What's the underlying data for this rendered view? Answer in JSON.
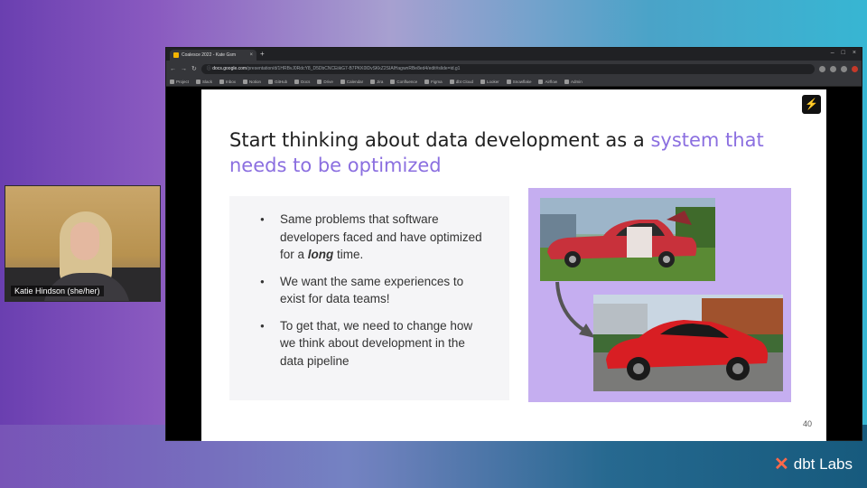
{
  "webcam": {
    "name_label": "Katie Hindson (she/her)"
  },
  "browser": {
    "tab_title": "Coalesce 2022 - Kate Gsm",
    "tab_close": "×",
    "new_tab": "+",
    "window_controls": [
      "–",
      "□",
      "×"
    ],
    "nav": {
      "back": "←",
      "forward": "→",
      "reload": "↻",
      "info": "ⓘ"
    },
    "url_host": "docs.google.com",
    "url_rest": "/presentation/d/1HRBvJ0RdcY8_D5DbCNCEiikG7-B7PKK0lDvSKkZ2SIAlHagwnRBe8ed4/edit#slide=id.g1",
    "bookmarks": [
      "Project",
      "Slack",
      "Inbox",
      "Notion",
      "GitHub",
      "Docs",
      "Drive",
      "Calendar",
      "Jira",
      "Confluence",
      "Figma",
      "dbt Cloud",
      "Looker",
      "Snowflake",
      "Airflow",
      "Admin"
    ]
  },
  "slide": {
    "title_main": "Start thinking about data development as a ",
    "title_highlight": "system that needs to be optimized",
    "bullet1_pre": "Same problems that software developers faced and have optimized for a ",
    "bullet1_em": "long",
    "bullet1_post": " time.",
    "bullet2": "We want the same experiences to exist for data teams!",
    "bullet3": "To get that, we need to change how we think about development in the data pipeline",
    "page_number": "40",
    "bolt": "⚡"
  },
  "brand": {
    "mark": "✕",
    "name": "dbt Labs"
  },
  "colors": {
    "accent": "#8b6fe0",
    "panel": "#c5aef0",
    "dbt_orange": "#ff694a"
  }
}
